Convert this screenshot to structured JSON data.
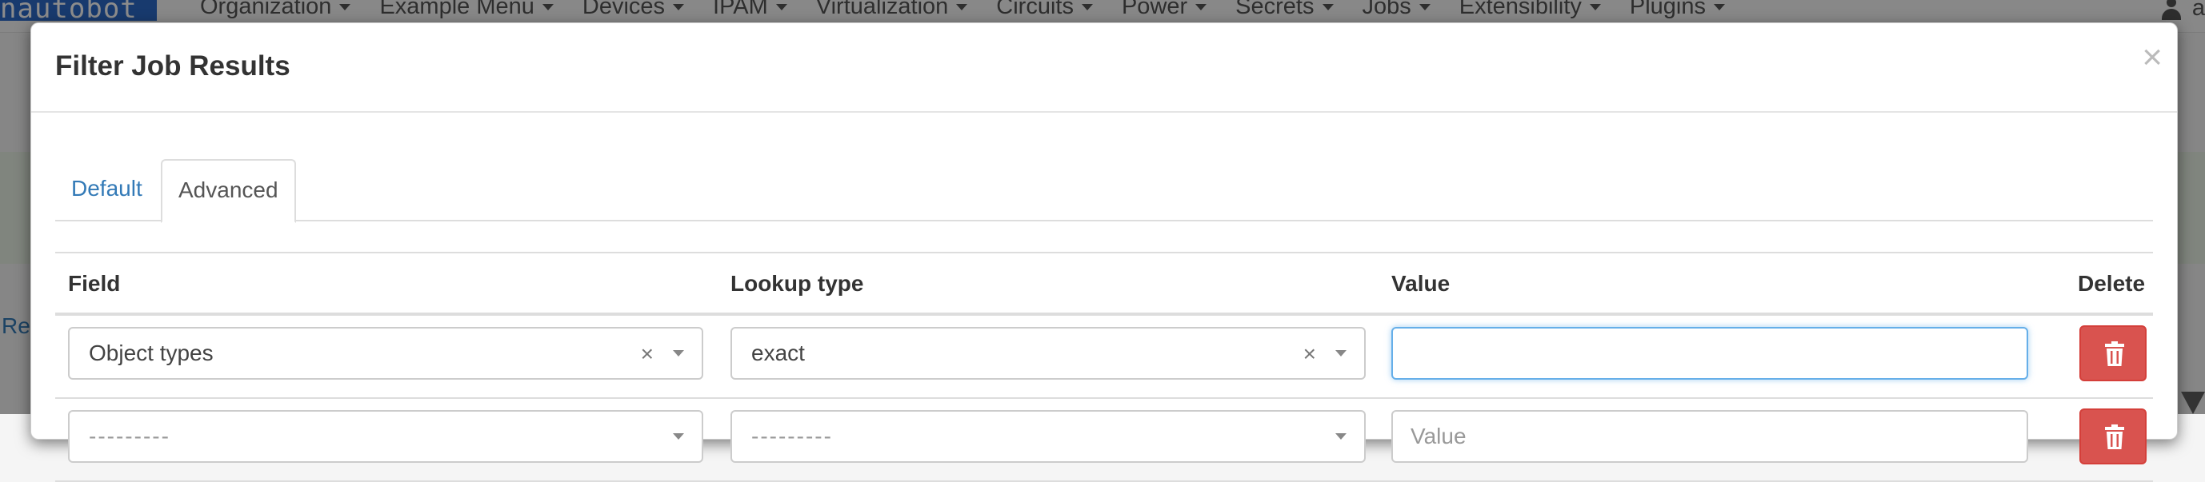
{
  "app": {
    "brand": "nautobot",
    "nav": [
      "Organization",
      "Example Menu",
      "Devices",
      "IPAM",
      "Virtualization",
      "Circuits",
      "Power",
      "Secrets",
      "Jobs",
      "Extensibility",
      "Plugins"
    ],
    "user_initial": "a",
    "behind_link": "Re"
  },
  "modal": {
    "title": "Filter Job Results",
    "close_glyph": "×",
    "tabs": [
      {
        "label": "Default",
        "active": false
      },
      {
        "label": "Advanced",
        "active": true
      }
    ],
    "table": {
      "headers": {
        "field": "Field",
        "lookup": "Lookup type",
        "value": "Value",
        "delete": "Delete"
      },
      "rows": [
        {
          "field": "Object types",
          "field_clear": "×",
          "lookup": "exact",
          "lookup_clear": "×",
          "value": "",
          "value_placeholder": ""
        },
        {
          "field": "---------",
          "lookup": "---------",
          "value": "",
          "value_placeholder": "Value"
        }
      ]
    }
  },
  "icons": {
    "delete": "trash-icon",
    "close": "close-icon",
    "caret": "caret-down-icon",
    "user": "user-icon"
  },
  "colors": {
    "brand": "#2d6ac8",
    "link": "#337ab7",
    "danger": "#d9534f",
    "focus": "#66afe9"
  }
}
